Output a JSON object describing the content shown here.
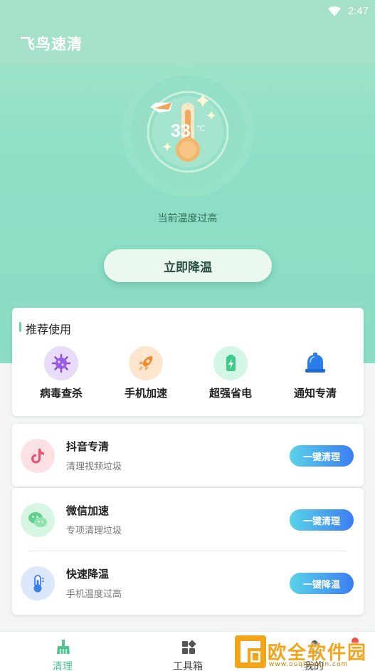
{
  "status_bar": {
    "time": "2:47"
  },
  "header": {
    "title": "飞鸟速清"
  },
  "temperature": {
    "value": "33",
    "unit": "℃",
    "status": "当前温度过高"
  },
  "cool_button": {
    "label": "立即降温"
  },
  "recommend": {
    "title": "推荐使用",
    "items": [
      {
        "label": "病毒查杀",
        "icon": "virus-icon"
      },
      {
        "label": "手机加速",
        "icon": "rocket-icon"
      },
      {
        "label": "超强省电",
        "icon": "battery-icon"
      },
      {
        "label": "通知专清",
        "icon": "bell-icon"
      }
    ]
  },
  "tasks": [
    {
      "name": "抖音专清",
      "sub": "清理视频垃圾",
      "button": "一键清理",
      "icon": "tiktok-icon"
    },
    {
      "name": "微信加速",
      "sub": "专项清理垃圾",
      "button": "一键清理",
      "icon": "wechat-icon"
    },
    {
      "name": "快速降温",
      "sub": "手机温度过高",
      "button": "一键降温",
      "icon": "thermometer-icon"
    }
  ],
  "bottom_nav": [
    {
      "label": "清理",
      "icon": "broom-icon",
      "active": true
    },
    {
      "label": "工具箱",
      "icon": "toolbox-icon",
      "active": false
    },
    {
      "label": "我的",
      "icon": "profile-icon",
      "active": false
    }
  ],
  "watermark": {
    "text": "欧全软件园",
    "url": "www.ouqiuanjin.com"
  },
  "colors": {
    "primary": "#8edfc6",
    "accent_green": "#4fc596",
    "button_gradient_start": "#5ad3e7",
    "button_gradient_end": "#3c7df2",
    "badge_red": "#f05050"
  }
}
